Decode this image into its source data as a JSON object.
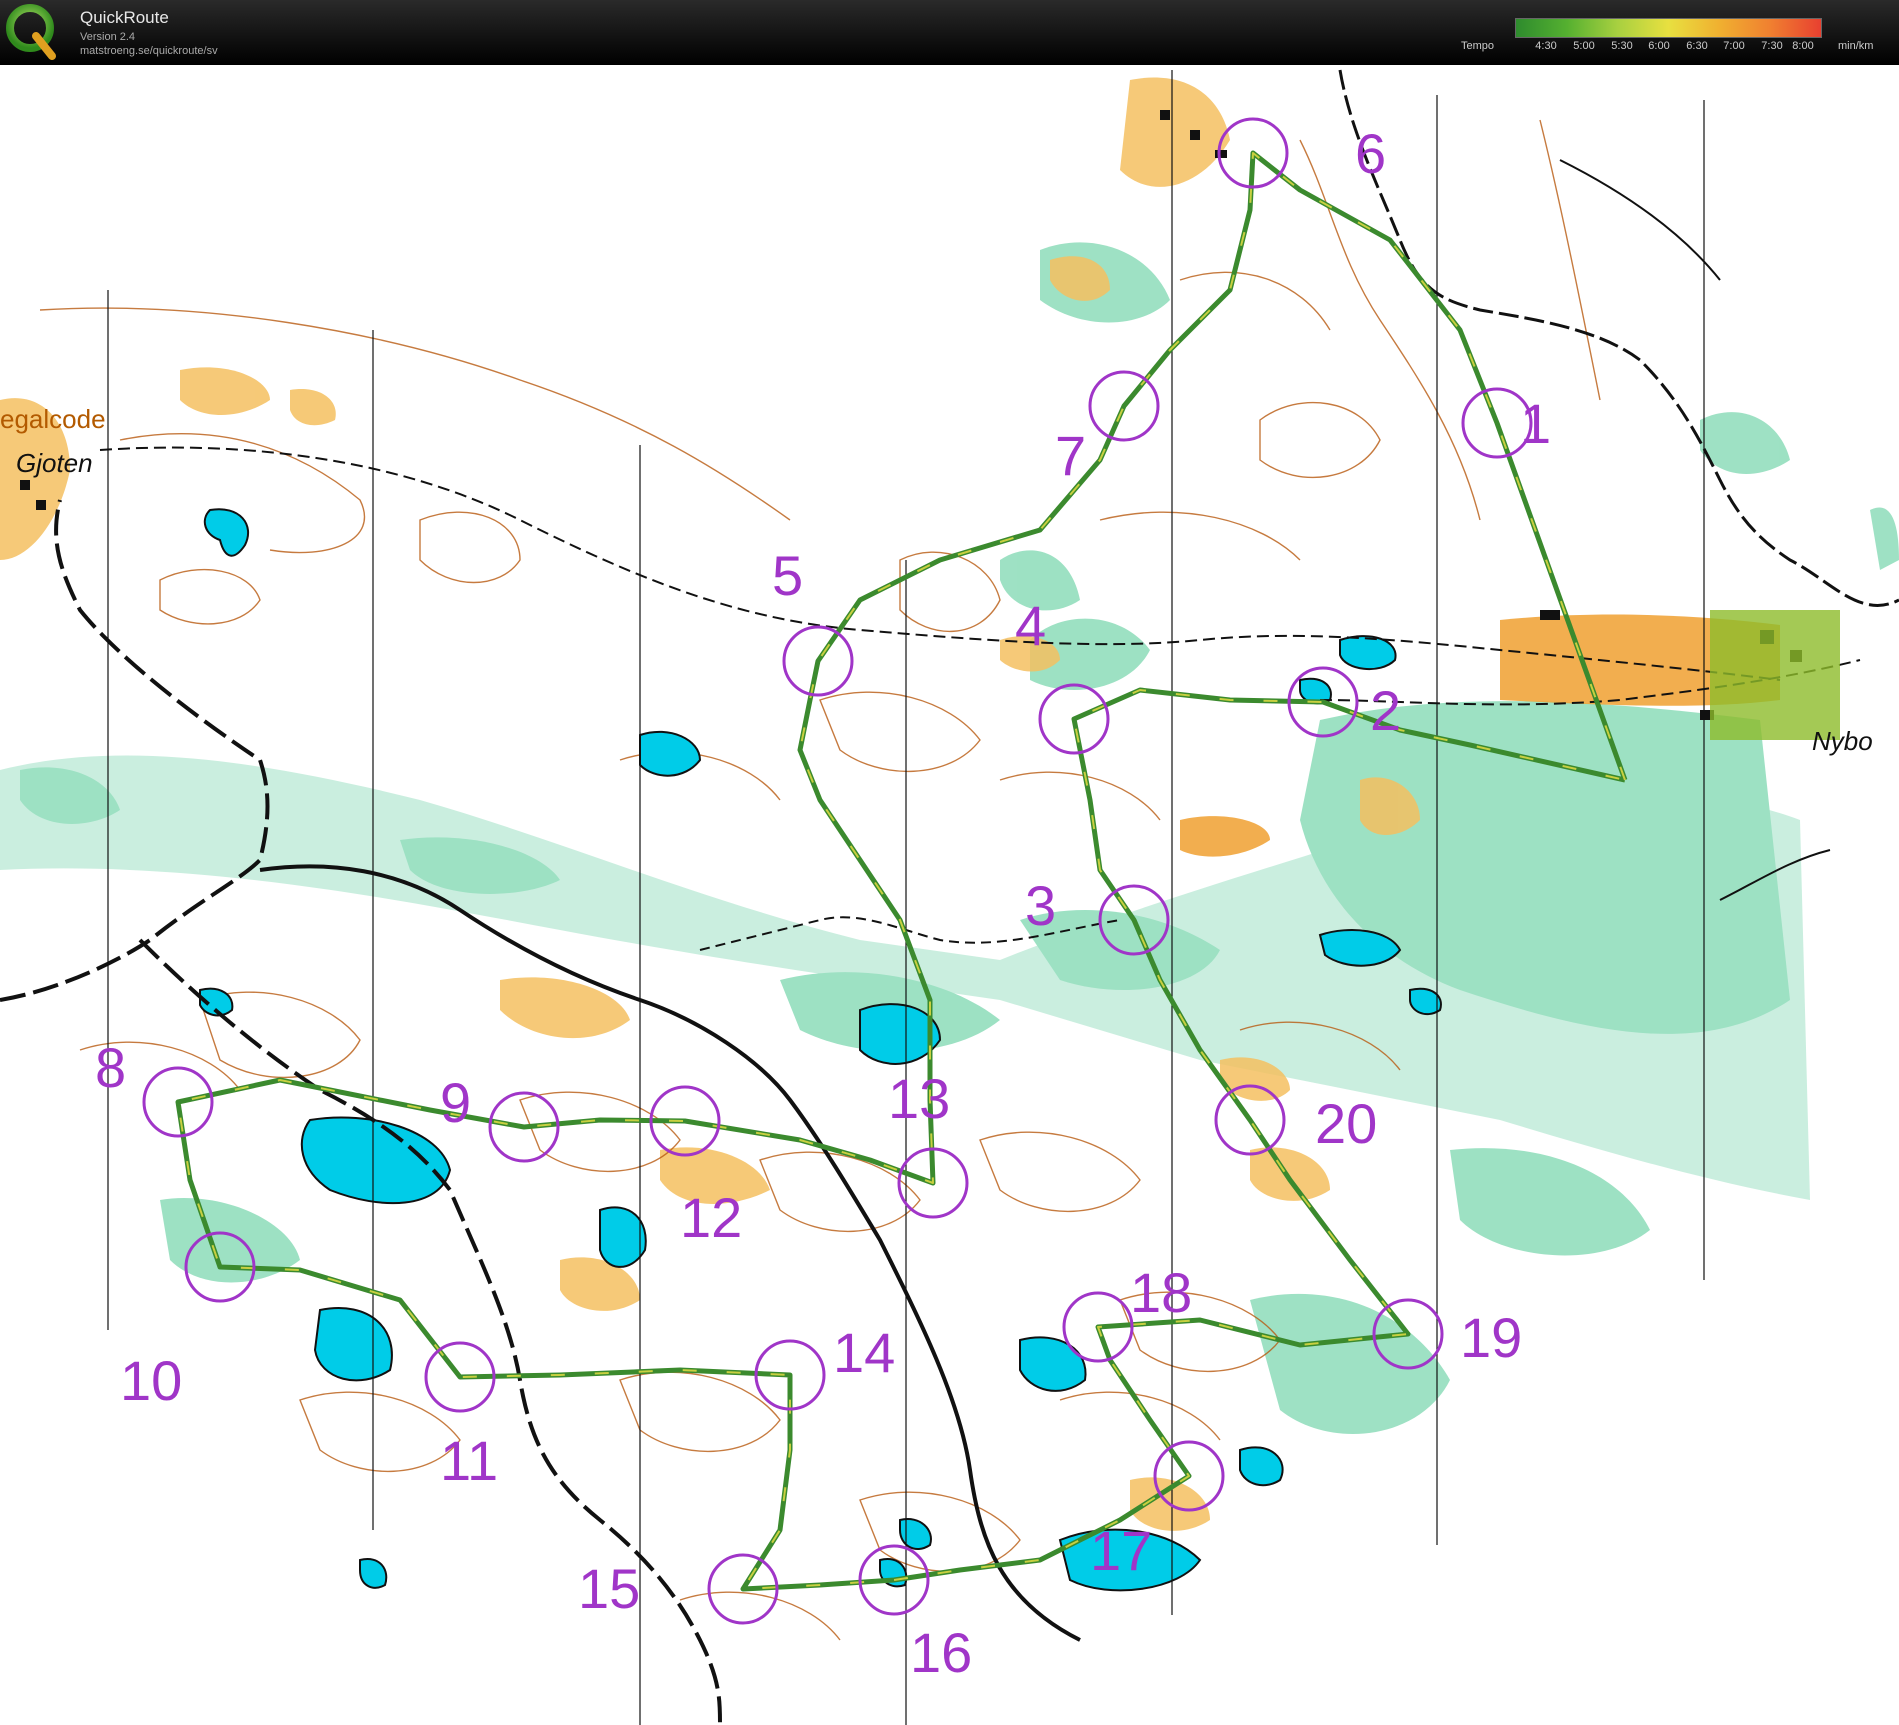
{
  "app": {
    "name": "QuickRoute",
    "version": "Version 2.4",
    "url": "matstroeng.se/quickroute/sv"
  },
  "tempo": {
    "label": "Tempo",
    "unit": "min/km",
    "ticks": [
      "4:30",
      "5:00",
      "5:30",
      "6:00",
      "6:30",
      "7:00",
      "7:30",
      "8:00"
    ],
    "gradient_colors": [
      "#2e8b2e",
      "#55b030",
      "#a8d040",
      "#e8e040",
      "#f0b030",
      "#f08030",
      "#e84030"
    ]
  },
  "map": {
    "place_names": {
      "gjoten": "Gjoten",
      "nybo": "Nybo",
      "legalcode": "egalcode"
    },
    "colors": {
      "control": "#a035c8",
      "water": "#00cce8",
      "green": "#7dd7b0",
      "open": "#f5c060",
      "contour": "#b85a10",
      "route": "#3b8a2e"
    },
    "controls": [
      {
        "number": "1"
      },
      {
        "number": "2"
      },
      {
        "number": "3"
      },
      {
        "number": "4"
      },
      {
        "number": "5"
      },
      {
        "number": "6"
      },
      {
        "number": "7"
      },
      {
        "number": "8"
      },
      {
        "number": "9"
      },
      {
        "number": "10"
      },
      {
        "number": "11"
      },
      {
        "number": "12"
      },
      {
        "number": "13"
      },
      {
        "number": "14"
      },
      {
        "number": "15"
      },
      {
        "number": "16"
      },
      {
        "number": "17"
      },
      {
        "number": "18"
      },
      {
        "number": "19"
      },
      {
        "number": "20"
      }
    ]
  }
}
